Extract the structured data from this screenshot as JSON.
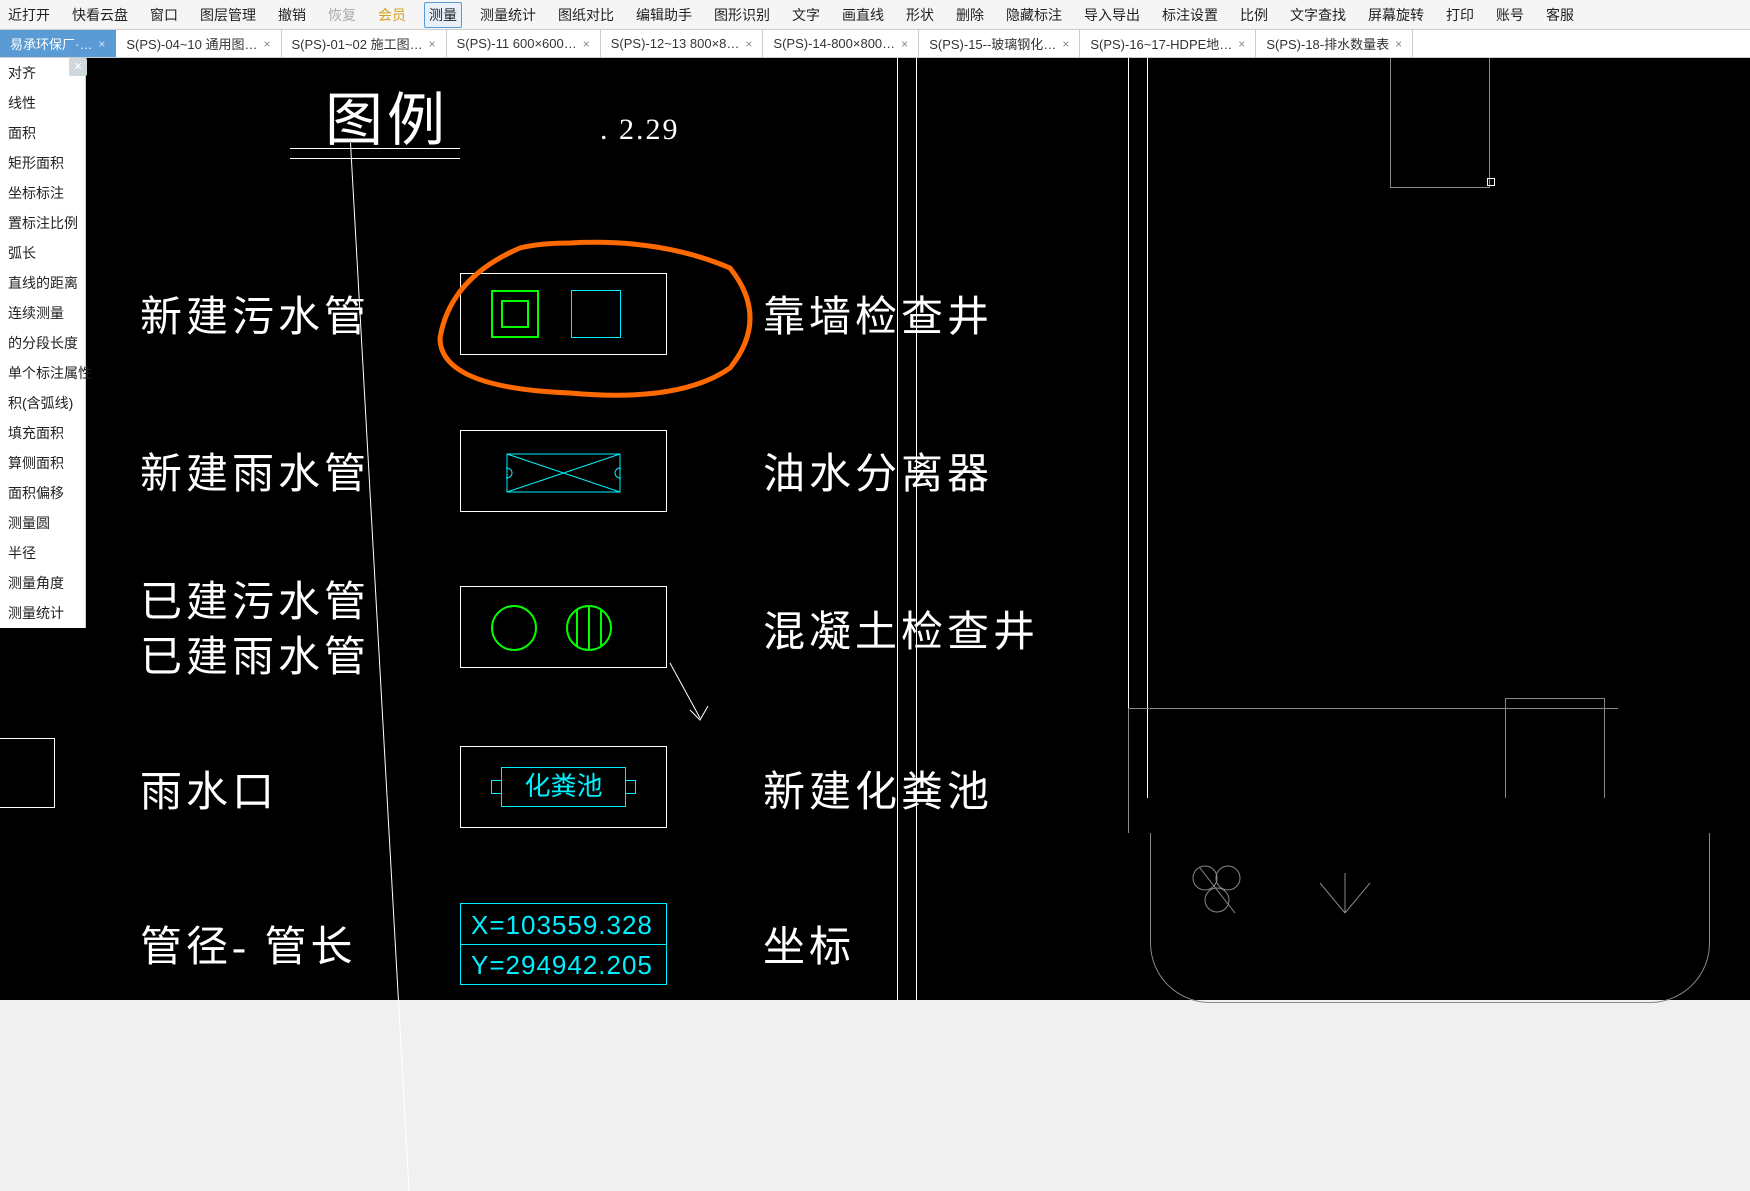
{
  "toolbar": {
    "items": [
      {
        "label": "近打开",
        "cls": ""
      },
      {
        "label": "快看云盘",
        "cls": ""
      },
      {
        "label": "窗口",
        "cls": ""
      },
      {
        "label": "图层管理",
        "cls": ""
      },
      {
        "label": "撤销",
        "cls": ""
      },
      {
        "label": "恢复",
        "cls": "disabled"
      },
      {
        "label": "会员",
        "cls": "gold"
      },
      {
        "label": "测量",
        "cls": "active"
      },
      {
        "label": "测量统计",
        "cls": ""
      },
      {
        "label": "图纸对比",
        "cls": ""
      },
      {
        "label": "编辑助手",
        "cls": ""
      },
      {
        "label": "图形识别",
        "cls": ""
      },
      {
        "label": "文字",
        "cls": ""
      },
      {
        "label": "画直线",
        "cls": ""
      },
      {
        "label": "形状",
        "cls": ""
      },
      {
        "label": "删除",
        "cls": ""
      },
      {
        "label": "隐藏标注",
        "cls": ""
      },
      {
        "label": "导入导出",
        "cls": ""
      },
      {
        "label": "标注设置",
        "cls": ""
      },
      {
        "label": "比例",
        "cls": ""
      },
      {
        "label": "文字查找",
        "cls": ""
      },
      {
        "label": "屏幕旋转",
        "cls": ""
      },
      {
        "label": "打印",
        "cls": ""
      },
      {
        "label": "账号",
        "cls": ""
      },
      {
        "label": "客服",
        "cls": ""
      }
    ]
  },
  "tabs": {
    "items": [
      {
        "label": "易承环保厂·…",
        "first": true
      },
      {
        "label": "S(PS)-04~10 通用图…",
        "first": false
      },
      {
        "label": "S(PS)-01~02 施工图…",
        "first": false
      },
      {
        "label": "S(PS)-11 600×600…",
        "first": false
      },
      {
        "label": "S(PS)-12~13 800×8…",
        "first": false
      },
      {
        "label": "S(PS)-14-800×800…",
        "first": false
      },
      {
        "label": "S(PS)-15--玻璃钢化…",
        "first": false
      },
      {
        "label": "S(PS)-16~17-HDPE地…",
        "first": false
      },
      {
        "label": "S(PS)-18-排水数量表",
        "first": false
      }
    ]
  },
  "sidebar": {
    "items": [
      "对齐",
      "线性",
      "面积",
      "矩形面积",
      "坐标标注",
      "置标注比例",
      "弧长",
      "直线的距离",
      "连续测量",
      "的分段长度",
      "单个标注属性",
      "积(含弧线)",
      "填充面积",
      "算侧面积",
      "面积偏移",
      "测量圆",
      "半径",
      "测量角度",
      "测量统计"
    ]
  },
  "legend": {
    "title": "图例",
    "note": ". 2.29",
    "rows": [
      {
        "left": "新建污水管",
        "right": "靠墙检查井"
      },
      {
        "left": "新建雨水管",
        "right": "油水分离器"
      },
      {
        "left": "已建污水管",
        "left2": "已建雨水管",
        "right": "混凝土检查井"
      },
      {
        "left": "雨水口",
        "right": "新建化粪池",
        "boxlabel": "化粪池"
      },
      {
        "left": "管径- 管长",
        "right": "坐标",
        "x": "X=103559.328",
        "y": "Y=294942.205"
      }
    ]
  }
}
